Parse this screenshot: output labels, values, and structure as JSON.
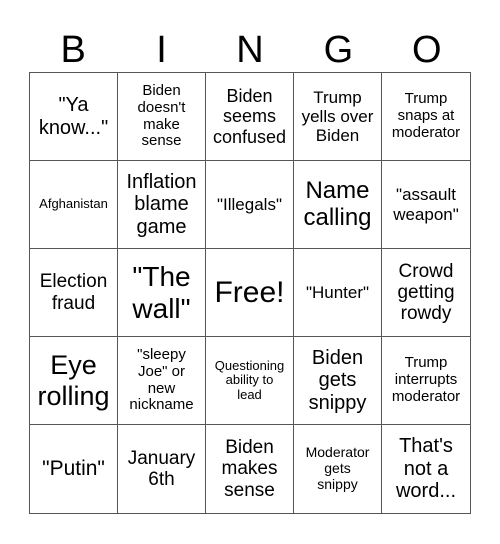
{
  "header": {
    "letters": [
      "B",
      "I",
      "N",
      "G",
      "O"
    ]
  },
  "board": {
    "rows": [
      [
        "\"Ya\nknow...\"",
        "Biden\ndoesn't\nmake\nsense",
        "Biden\nseems\nconfused",
        "Trump\nyells over\nBiden",
        "Trump\nsnaps at\nmoderator"
      ],
      [
        "Afghanistan",
        "Inflation\nblame\ngame",
        "\"Illegals\"",
        "Name\ncalling",
        "\"assault\nweapon\""
      ],
      [
        "Election\nfraud",
        "\"The\nwall\"",
        "Free!",
        "\"Hunter\"",
        "Crowd\ngetting\nrowdy"
      ],
      [
        "Eye\nrolling",
        "\"sleepy\nJoe\" or\nnew\nnickname",
        "Questioning\nability to\nlead",
        "Biden\ngets\nsnippy",
        "Trump\ninterrupts\nmoderator"
      ],
      [
        "\"Putin\"",
        "January\n6th",
        "Biden\nmakes\nsense",
        "Moderator\ngets\nsnippy",
        "That's\nnot a\nword..."
      ]
    ],
    "free_space": "Free!"
  },
  "colors": {
    "grid_line": "#555555",
    "text": "#000000",
    "background": "#ffffff"
  }
}
